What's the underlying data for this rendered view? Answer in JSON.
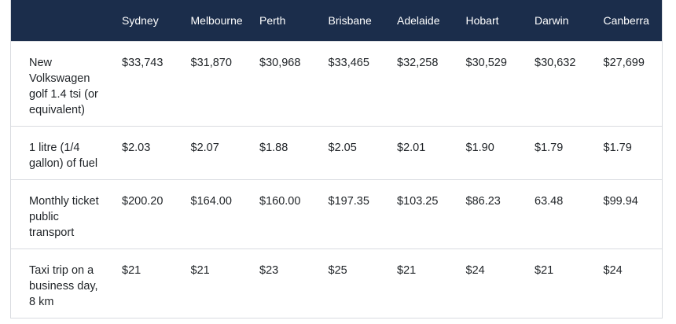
{
  "table": {
    "corner_label": "",
    "columns": [
      "Sydney",
      "Melbourne",
      "Perth",
      "Brisbane",
      "Adelaide",
      "Hobart",
      "Darwin",
      "Canberra"
    ],
    "rows": [
      {
        "item": "New Volkswagen golf 1.4 tsi (or equivalent)",
        "values": [
          "$33,743",
          "$31,870",
          "$30,968",
          "$33,465",
          "$32,258",
          "$30,529",
          "$30,632",
          "$27,699"
        ]
      },
      {
        "item": "1 litre (1/4 gallon) of fuel",
        "values": [
          "$2.03",
          "$2.07",
          "$1.88",
          "$2.05",
          "$2.01",
          "$1.90",
          "$1.79",
          "$1.79"
        ]
      },
      {
        "item": "Monthly ticket public transport",
        "values": [
          "$200.20",
          "$164.00",
          "$160.00",
          "$197.35",
          "$103.25",
          "$86.23",
          "63.48",
          "$99.94"
        ]
      },
      {
        "item": "Taxi trip on a business day, 8 km",
        "values": [
          "$21",
          "$21",
          "$23",
          "$25",
          "$21",
          "$24",
          "$21",
          "$24"
        ]
      }
    ]
  },
  "colors": {
    "header_bg": "#1b2d4b",
    "header_text": "#ffffff",
    "cell_text": "#212529",
    "border": "#d9dbe0"
  }
}
